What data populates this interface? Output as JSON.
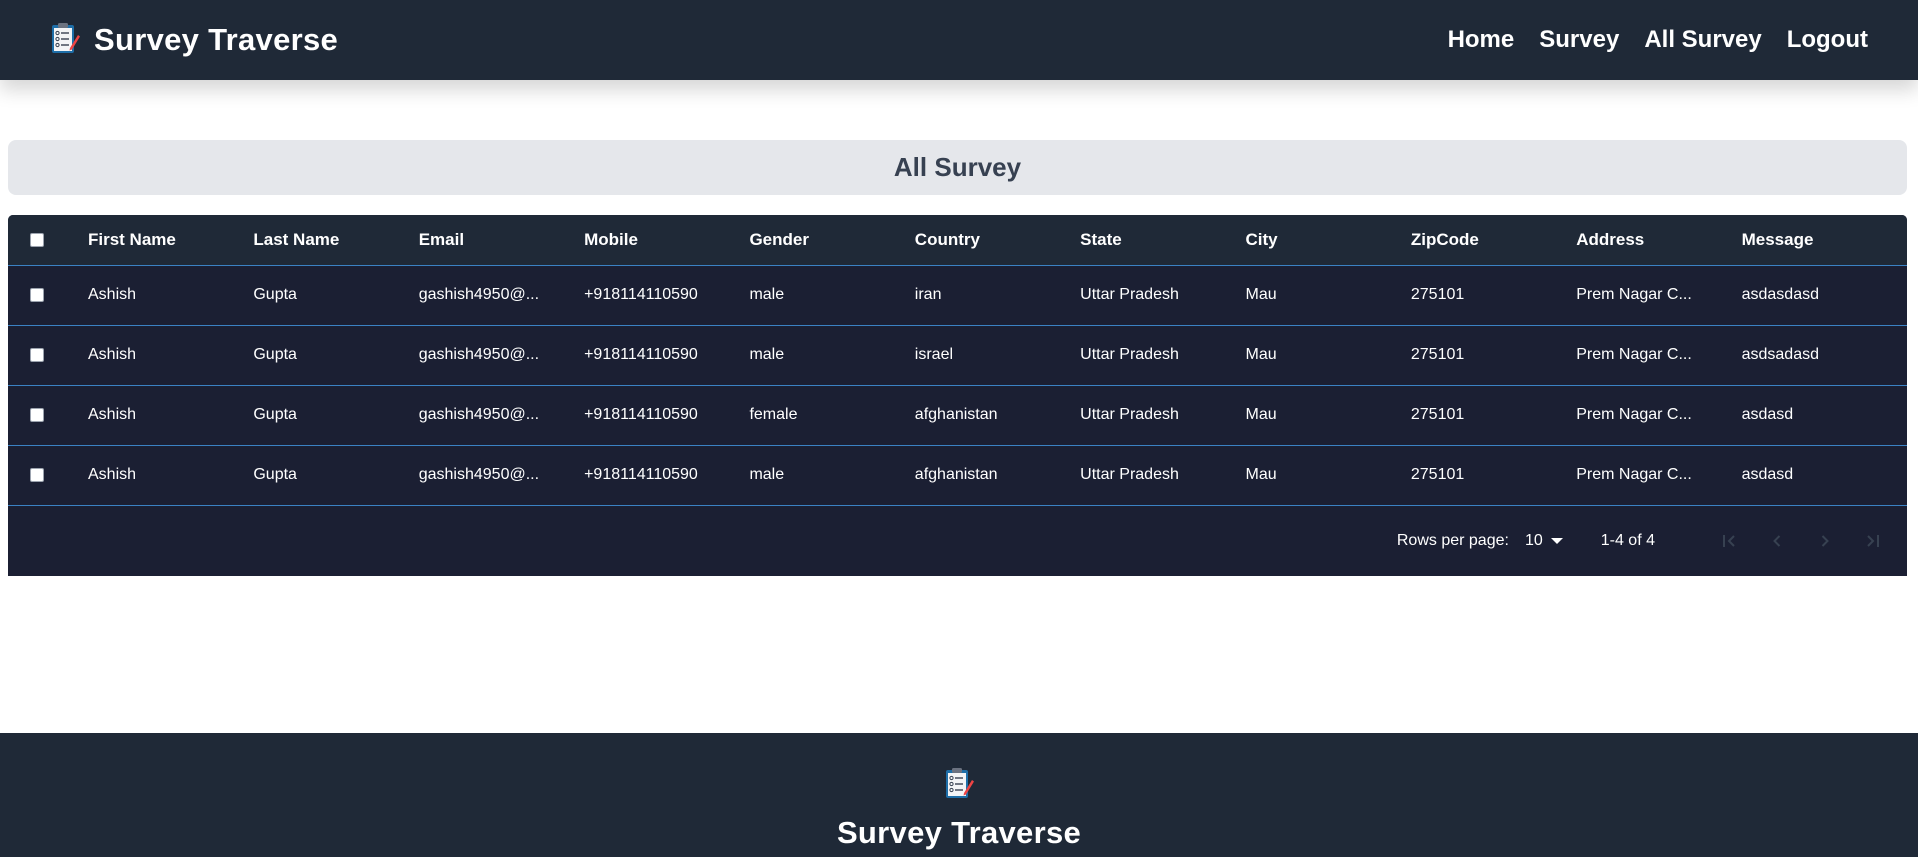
{
  "header": {
    "brand_logo": "clipboard-checklist-icon",
    "brand_title": "Survey Traverse",
    "nav": [
      "Home",
      "Survey",
      "All Survey",
      "Logout"
    ]
  },
  "page": {
    "title": "All Survey"
  },
  "table": {
    "columns": [
      "First Name",
      "Last Name",
      "Email",
      "Mobile",
      "Gender",
      "Country",
      "State",
      "City",
      "ZipCode",
      "Address",
      "Message"
    ],
    "rows": [
      [
        "Ashish",
        "Gupta",
        "gashish4950@...",
        "+918114110590",
        "male",
        "iran",
        "Uttar Pradesh",
        "Mau",
        "275101",
        "Prem Nagar C...",
        "asdasdasd"
      ],
      [
        "Ashish",
        "Gupta",
        "gashish4950@...",
        "+918114110590",
        "male",
        "israel",
        "Uttar Pradesh",
        "Mau",
        "275101",
        "Prem Nagar C...",
        "asdsadasd"
      ],
      [
        "Ashish",
        "Gupta",
        "gashish4950@...",
        "+918114110590",
        "female",
        "afghanistan",
        "Uttar Pradesh",
        "Mau",
        "275101",
        "Prem Nagar C...",
        "asdasd"
      ],
      [
        "Ashish",
        "Gupta",
        "gashish4950@...",
        "+918114110590",
        "male",
        "afghanistan",
        "Uttar Pradesh",
        "Mau",
        "275101",
        "Prem Nagar C...",
        "asdasd"
      ]
    ]
  },
  "pagination": {
    "rows_per_page_label": "Rows per page:",
    "rows_per_page_value": "10",
    "range": "1-4 of 4"
  },
  "footer": {
    "logo": "clipboard-checklist-icon",
    "title": "Survey Traverse"
  },
  "colors": {
    "navbar_bg": "#1f2937",
    "table_bg": "#1b1f33",
    "row_divider": "#3b82c4",
    "title_bar_bg": "#e5e7eb",
    "title_text": "#374151"
  }
}
